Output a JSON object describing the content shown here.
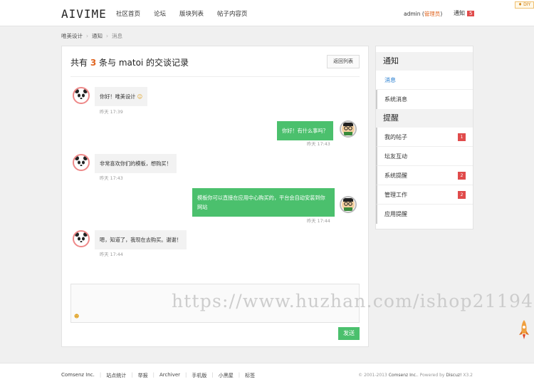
{
  "header": {
    "logo": "AIVIME",
    "nav": [
      "社区首页",
      "论坛",
      "版块列表",
      "帖子内容页"
    ],
    "user": "admin",
    "role": "管理员",
    "notice_label": "通知",
    "notice_count": "5",
    "diy": "DIY"
  },
  "breadcrumb": {
    "home": "唯美设计",
    "section": "通知",
    "current": "消息",
    "sep": "›"
  },
  "conversation": {
    "title_prefix": "共有 ",
    "count": "3",
    "title_suffix": " 条与 matoi 的交谈记录",
    "back_label": "返回列表",
    "messages": [
      {
        "text": "你好！唯美设计",
        "time": "昨天 17:39"
      },
      {
        "text": "你好！有什么事吗？",
        "time": "昨天 17:43"
      },
      {
        "text": "非常喜欢你们的模板，想购买！",
        "time": "昨天 17:43"
      },
      {
        "text": "模板你可以直接在应用中心购买的，平台会自动安装到你网站",
        "time": "昨天 17:44"
      },
      {
        "text": "嗯，知道了，我现在去购买。谢谢！",
        "time": "昨天 17:44"
      }
    ],
    "send_label": "发送"
  },
  "sidebar": {
    "notice_header": "通知",
    "items_notice": [
      {
        "label": "消息"
      },
      {
        "label": "系统消息"
      }
    ],
    "remind_header": "提醒",
    "items_remind": [
      {
        "label": "我的帖子",
        "badge": "1"
      },
      {
        "label": "坛友互动"
      },
      {
        "label": "系统提醒",
        "badge": "2"
      },
      {
        "label": "管理工作",
        "badge": "2"
      },
      {
        "label": "应用提醒"
      }
    ]
  },
  "watermark": "https://www.huzhan.com/ishop21194",
  "footer": {
    "links": [
      "Comsenz Inc.",
      "站点统计",
      "举报",
      "Archiver",
      "手机版",
      "小黑屋",
      "标签"
    ],
    "copy_prefix": "© 2001-2013 ",
    "company": "Comsenz Inc.",
    "powered": ". Powered by ",
    "product": "Discuz!",
    "version": " X3.2"
  },
  "colors": {
    "accent": "#4bc06d",
    "brand_orange": "#e06520",
    "badge_red": "#e04b4b",
    "link_blue": "#2a7fd0"
  }
}
